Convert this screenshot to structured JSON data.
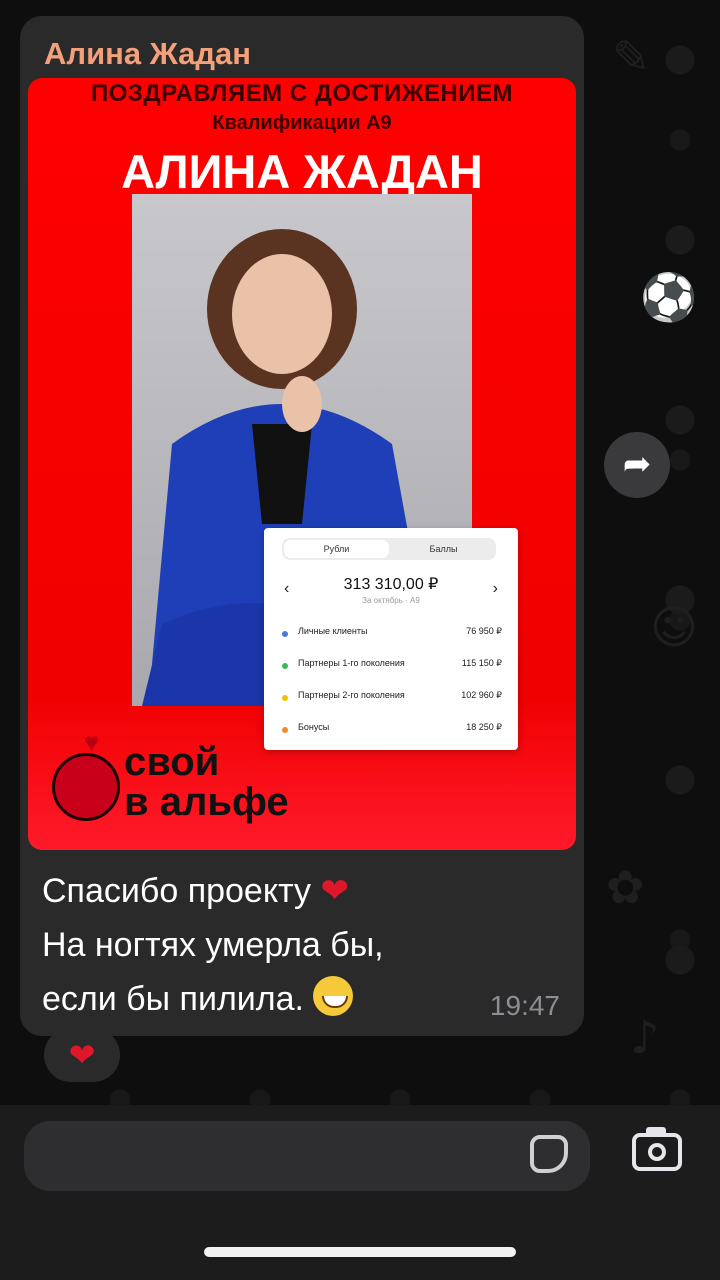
{
  "message": {
    "sender": "Алина Жадан",
    "lines": [
      "Спасибо проекту",
      "На ногтях умерла бы,",
      "если бы пилила."
    ],
    "time": "19:47",
    "reaction": "❤"
  },
  "image": {
    "congrats": "ПОЗДРАВЛЯЕМ С ДОСТИЖЕНИЕМ",
    "qualification": "Квалификации А9",
    "name": "АЛИНА ЖАДАН",
    "logo": [
      "свой",
      "в альфе"
    ],
    "stats": {
      "tabs": [
        "Рубли",
        "Баллы"
      ],
      "amount": "313 310,00 ₽",
      "period": "За октябрь · А9",
      "rows": [
        {
          "label": "Личные клиенты",
          "value": "76 950 ₽",
          "color": "#4a7bd8"
        },
        {
          "label": "Партнеры 1-го поколения",
          "value": "115 150 ₽",
          "color": "#3cba54"
        },
        {
          "label": "Партнеры 2-го поколения",
          "value": "102 960 ₽",
          "color": "#f2c200"
        },
        {
          "label": "Бонусы",
          "value": "18 250 ₽",
          "color": "#f08a30"
        }
      ]
    }
  },
  "colors": {
    "sender": "#f4a07a",
    "bubble": "#2a2a2b",
    "brand_red": "#ff0000"
  },
  "icons": {
    "share": "share-arrow-icon",
    "sticker": "sticker-icon",
    "camera": "camera-icon"
  }
}
